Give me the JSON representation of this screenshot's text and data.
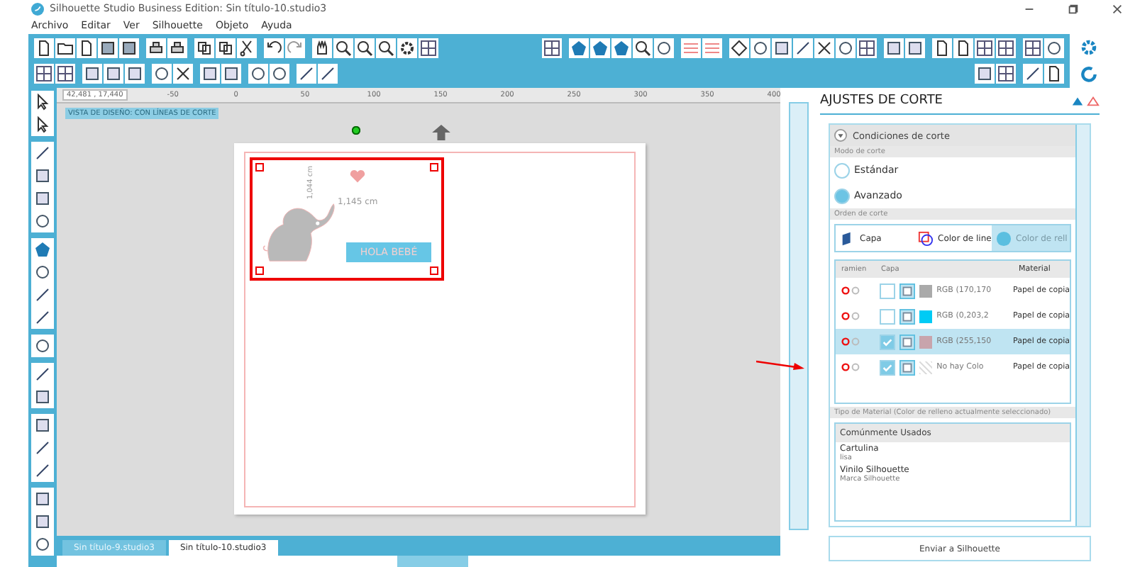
{
  "window": {
    "title": "Silhouette Studio Business Edition: Sin título-10.studio3"
  },
  "menu": [
    "Archivo",
    "Editar",
    "Ver",
    "Silhouette",
    "Objeto",
    "Ayuda"
  ],
  "ruler": {
    "readout": "42,481 , 17,440",
    "ticks": [
      "-50",
      "0",
      "50",
      "100",
      "150",
      "200",
      "250",
      "300",
      "350",
      "400"
    ]
  },
  "view_label": "VISTA DE DISEÑO: CON LÍNEAS DE CORTE",
  "design": {
    "banner_text": "HOLA BEBÉ",
    "height_label": "1,044 cm",
    "width_label": "1,145 cm"
  },
  "doc_tabs": [
    {
      "label": "Sin título-9.studio3",
      "selected": false
    },
    {
      "label": "Sin título-10.studio3",
      "selected": true
    }
  ],
  "panel": {
    "title": "AJUSTES DE CORTE",
    "section": "Condiciones de corte",
    "mode_label": "Modo de corte",
    "modes": [
      {
        "label": "Estándar",
        "selected": false
      },
      {
        "label": "Avanzado",
        "selected": true
      }
    ],
    "order_label": "Orden de corte",
    "order_tabs": [
      {
        "label": "Capa",
        "selected": false
      },
      {
        "label": "Color de line",
        "selected": false
      },
      {
        "label": "Color de rell",
        "selected": true
      }
    ],
    "columns": [
      "ramien",
      "Capa",
      "Material"
    ],
    "rows": [
      {
        "checked": false,
        "selected": false,
        "color": "#aaaaaa",
        "layer": "RGB (170,170",
        "material": "Papel de copia"
      },
      {
        "checked": false,
        "selected": false,
        "color": "#00cbf5",
        "layer": "RGB (0,203,2",
        "material": "Papel de copia"
      },
      {
        "checked": true,
        "selected": true,
        "color": "#c8a4ac",
        "layer": "RGB (255,150",
        "material": "Papel de copia"
      },
      {
        "checked": true,
        "selected": false,
        "color": null,
        "layer": "No hay Colo",
        "material": "Papel de copia"
      }
    ],
    "material_label": "Tipo de Material (Color de relleno actualmente seleccionado)",
    "material_group": "Comúnmente Usados",
    "materials": [
      {
        "name": "Cartulina",
        "sub": "lisa"
      },
      {
        "name": "Vinilo Silhouette",
        "sub": "Marca Silhouette"
      }
    ],
    "send_button": "Enviar a Silhouette"
  }
}
